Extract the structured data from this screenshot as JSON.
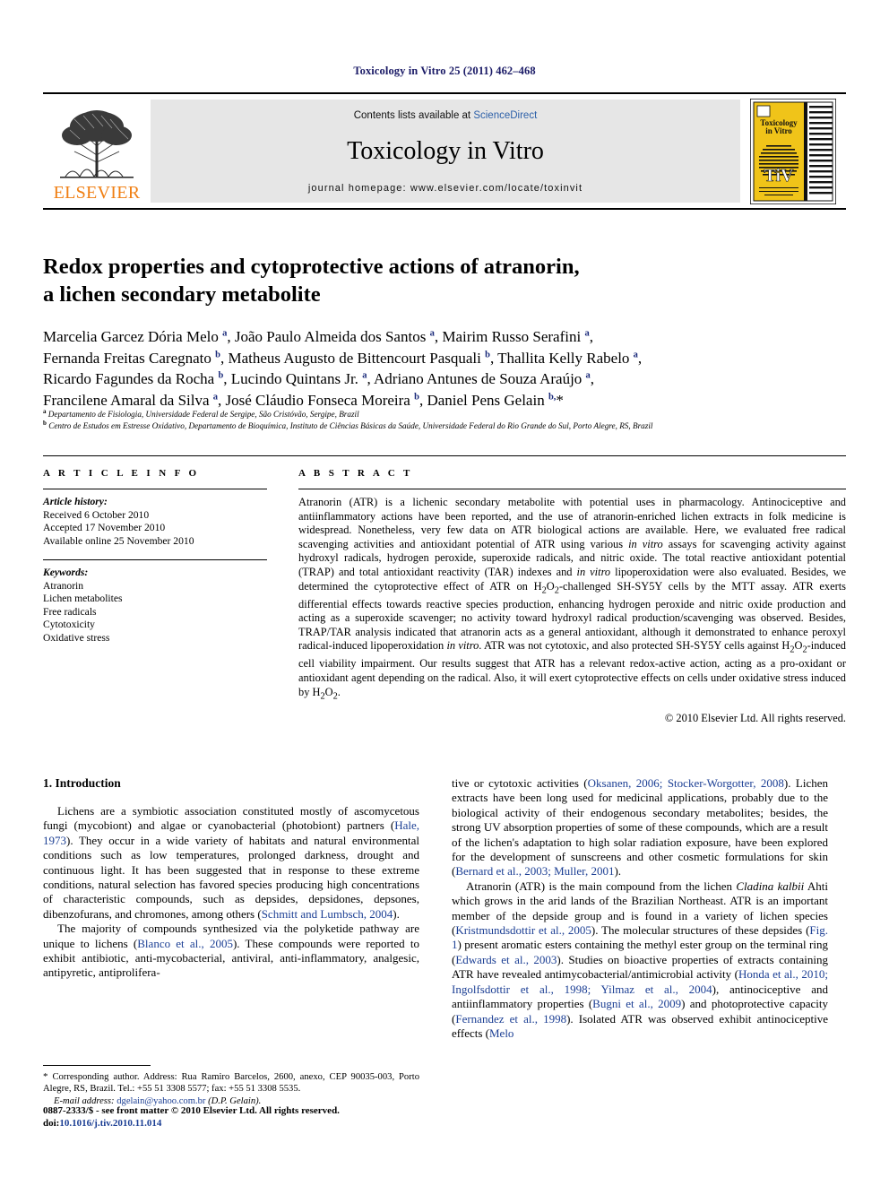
{
  "running_head": "Toxicology in Vitro 25 (2011) 462–468",
  "masthead": {
    "contents_prefix": "Contents lists available at ",
    "sciencedirect": "ScienceDirect",
    "journal_title": "Toxicology in Vitro",
    "homepage": "journal homepage: www.elsevier.com/locate/toxinvit",
    "elsevier_wordmark": "ELSEVIER",
    "cover": {
      "line1": "Toxicology",
      "line2": "in Vitro",
      "logo_text": "TiV",
      "footer1": "The Official Journal of the European Society of Toxicology in Vitro",
      "footer2": "and The American Society for Cellular and Computational Toxicology",
      "bg_color": "#f0c419"
    }
  },
  "article": {
    "title_line1": "Redox properties and cytoprotective actions of atranorin,",
    "title_line2": "a lichen secondary metabolite",
    "authors_html": "Marcelia Garcez Dória Melo <sup>a</sup>, João Paulo Almeida dos Santos <sup>a</sup>, Mairim Russo Serafini <sup>a</sup>,<br>Fernanda Freitas Caregnato <sup>b</sup>, Matheus Augusto de Bittencourt Pasquali <sup>b</sup>, Thallita Kelly Rabelo <sup>a</sup>,<br>Ricardo Fagundes da Rocha <sup>b</sup>, Lucindo Quintans Jr. <sup>a</sup>, Adriano Antunes de Souza Araújo <sup>a</sup>,<br>Francilene Amaral da Silva <sup>a</sup>, José Cláudio Fonseca Moreira <sup>b</sup>, Daniel Pens Gelain <sup>b,</sup>*",
    "affiliation_a_html": "<sup>a</sup> Departamento de Fisiologia, Universidade Federal de Sergipe, São Cristóvão, Sergipe, Brazil",
    "affiliation_b_html": "<sup>b</sup> Centro de Estudos em Estresse Oxidativo, Departamento de Bioquímica, Instituto de Ciências Básicas da Saúde, Universidade Federal do Rio Grande do Sul, Porto Alegre, RS, Brazil"
  },
  "article_info": {
    "heading": "A R T I C L E    I N F O",
    "history_label": "Article history:",
    "received": "Received 6 October 2010",
    "accepted": "Accepted 17 November 2010",
    "available": "Available online 25 November 2010",
    "keywords_label": "Keywords:",
    "keywords": [
      "Atranorin",
      "Lichen metabolites",
      "Free radicals",
      "Cytotoxicity",
      "Oxidative stress"
    ]
  },
  "abstract": {
    "heading": "A B S T R A C T",
    "text_html": "Atranorin (ATR) is a lichenic secondary metabolite with potential uses in pharmacology. Antinociceptive and antiinflammatory actions have been reported, and the use of atranorin-enriched lichen extracts in folk medicine is widespread. Nonetheless, very few data on ATR biological actions are available. Here, we evaluated free radical scavenging activities and antioxidant potential of ATR using various <i>in vitro</i> assays for scavenging activity against hydroxyl radicals, hydrogen peroxide, superoxide radicals, and nitric oxide. The total reactive antioxidant potential (TRAP) and total antioxidant reactivity (TAR) indexes and <i>in vitro</i> lipoperoxidation were also evaluated. Besides, we determined the cytoprotective effect of ATR on H<sub>2</sub>O<sub>2</sub>-challenged SH-SY5Y cells by the MTT assay. ATR exerts differential effects towards reactive species production, enhancing hydrogen peroxide and nitric oxide production and acting as a superoxide scavenger; no activity toward hydroxyl radical production/scavenging was observed. Besides, TRAP/TAR analysis indicated that atranorin acts as a general antioxidant, although it demonstrated to enhance peroxyl radical-induced lipoperoxidation <i>in vitro</i>. ATR was not cytotoxic, and also protected SH-SY5Y cells against H<sub>2</sub>O<sub>2</sub>-induced cell viability impairment. Our results suggest that ATR has a relevant redox-active action, acting as a pro-oxidant or antioxidant agent depending on the radical. Also, it will exert cytoprotective effects on cells under oxidative stress induced by H<sub>2</sub>O<sub>2</sub>.",
    "copyright": "© 2010 Elsevier Ltd. All rights reserved."
  },
  "introduction": {
    "heading": "1. Introduction",
    "left_paragraphs_html": [
      "Lichens are a symbiotic association constituted mostly of ascomycetous fungi (mycobiont) and algae or cyanobacterial (photobiont) partners (<span class=\"cite\">Hale, 1973</span>). They occur in a wide variety of habitats and natural environmental conditions such as low temperatures, prolonged darkness, drought and continuous light. It has been suggested that in response to these extreme conditions, natural selection has favored species producing high concentrations of characteristic compounds, such as depsides, depsidones, depsones, dibenzofurans, and chromones, among others (<span class=\"cite\">Schmitt and Lumbsch, 2004</span>).",
      "The majority of compounds synthesized via the polyketide pathway are unique to lichens (<span class=\"cite\">Blanco et al., 2005</span>). These compounds were reported to exhibit antibiotic, anti-mycobacterial, antiviral, anti-inflammatory, analgesic, antipyretic, antiprolifera-"
    ],
    "right_paragraphs_html": [
      "tive or cytotoxic activities (<span class=\"cite\">Oksanen, 2006; Stocker-Worgotter, 2008</span>). Lichen extracts have been long used for medicinal applications, probably due to the biological activity of their endogenous secondary metabolites; besides, the strong UV absorption properties of some of these compounds, which are a result of the lichen's adaptation to high solar radiation exposure, have been explored for the development of sunscreens and other cosmetic formulations for skin (<span class=\"cite\">Bernard et al., 2003; Muller, 2001</span>).",
      "Atranorin (ATR) is the main compound from the lichen <i>Cladina kalbii</i> Ahti which grows in the arid lands of the Brazilian Northeast. ATR is an important member of the depside group and is found in a variety of lichen species (<span class=\"cite\">Kristmundsdottir et al., 2005</span>). The molecular structures of these depsides (<span class=\"cite\">Fig. 1</span>) present aromatic esters containing the methyl ester group on the terminal ring (<span class=\"cite\">Edwards et al., 2003</span>). Studies on bioactive properties of extracts containing ATR have revealed antimycobacterial/antimicrobial activity (<span class=\"cite\">Honda et al., 2010; Ingolfsdottir et al., 1998; Yilmaz et al., 2004</span>), antinociceptive and antiinflammatory properties (<span class=\"cite\">Bugni et al., 2009</span>) and photoprotective capacity (<span class=\"cite\">Fernandez et al., 1998</span>). Isolated ATR was observed exhibit antinociceptive effects (<span class=\"cite\">Melo</span>"
    ]
  },
  "footnote": {
    "corresponding_html": "<span class=\"star\">*</span> Corresponding author. Address: Rua Ramiro Barcelos, 2600, anexo, CEP 90035-003, Porto Alegre, RS, Brazil. Tel.: +55 51 3308 5577; fax: +55 51 3308 5535.",
    "email_label": "E-mail address:",
    "email": "dgelain@yahoo.com.br",
    "email_suffix": " (D.P. Gelain)."
  },
  "page_footer": {
    "issn_line": "0887-2333/$ - see front matter © 2010 Elsevier Ltd. All rights reserved.",
    "doi_label": "doi:",
    "doi": "10.1016/j.tiv.2010.11.014"
  }
}
